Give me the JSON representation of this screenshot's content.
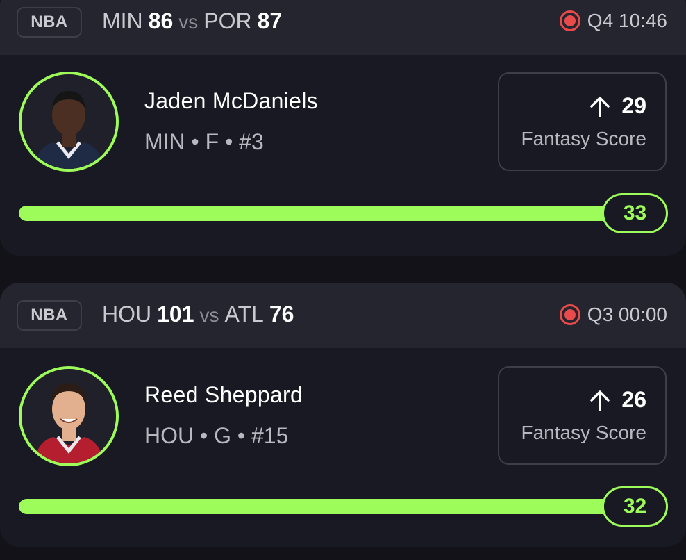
{
  "cards": [
    {
      "league": "NBA",
      "matchup": {
        "team_a": "MIN",
        "score_a": "86",
        "vs": "vs",
        "team_b": "POR",
        "score_b": "87"
      },
      "status": "Q4 10:46",
      "player": {
        "name": "Jaden McDaniels",
        "meta": "MIN • F • #3",
        "skin": "#4a2f22",
        "jersey": "#1f2a44"
      },
      "fantasy": {
        "value": "29",
        "label": "Fantasy Score",
        "trend_icon": "arrow-up-icon"
      },
      "progress": {
        "value": "33",
        "fill_fraction": 0.99
      }
    },
    {
      "league": "NBA",
      "matchup": {
        "team_a": "HOU",
        "score_a": "101",
        "vs": "vs",
        "team_b": "ATL",
        "score_b": "76"
      },
      "status": "Q3 00:00",
      "player": {
        "name": "Reed Sheppard",
        "meta": "HOU • G • #15",
        "skin": "#e3b08f",
        "jersey": "#b41e2e"
      },
      "fantasy": {
        "value": "26",
        "label": "Fantasy Score",
        "trend_icon": "arrow-up-icon"
      },
      "progress": {
        "value": "32",
        "fill_fraction": 0.99
      }
    }
  ],
  "colors": {
    "accent": "#9efc5a",
    "live": "#e94a4a",
    "background": "#121218",
    "card": "#191923",
    "header": "#25252f"
  }
}
